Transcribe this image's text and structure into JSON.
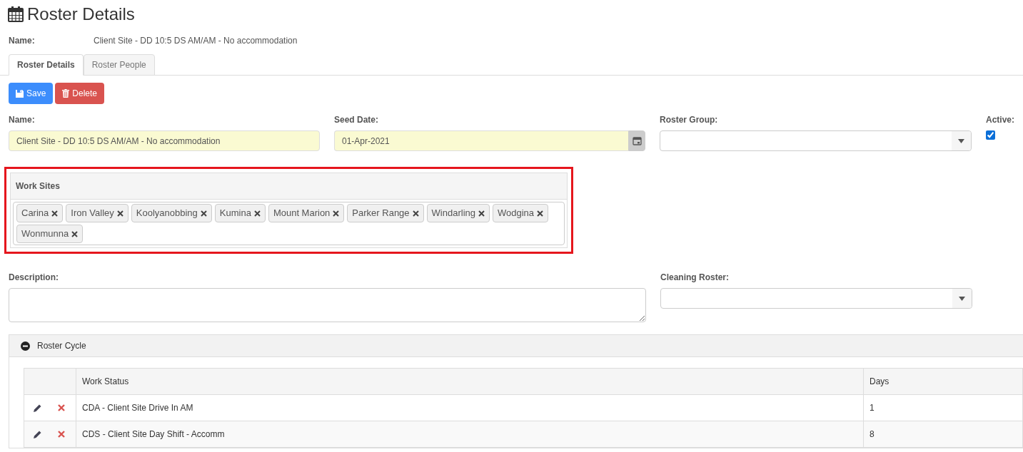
{
  "page": {
    "title": "Roster Details"
  },
  "summary": {
    "label": "Name:",
    "value": "Client Site - DD 10:5 DS AM/AM - No accommodation"
  },
  "tabs": [
    {
      "label": "Roster Details",
      "selected": true
    },
    {
      "label": "Roster People",
      "selected": false
    }
  ],
  "actions": [
    {
      "kind": "save",
      "label": "Save"
    },
    {
      "kind": "delete",
      "label": "Delete"
    }
  ],
  "fields": {
    "name": {
      "label": "Name:",
      "value": "Client Site - DD 10:5 DS AM/AM - No accommodation"
    },
    "seed_date": {
      "label": "Seed Date:",
      "value": "01-Apr-2021"
    },
    "roster_group": {
      "label": "Roster Group:"
    },
    "active": {
      "label": "Active:",
      "checked": true
    }
  },
  "work_sites": {
    "title": "Work Sites",
    "highlighted": true,
    "tags": [
      "Carina",
      "Iron Valley",
      "Koolyanobbing",
      "Kumina",
      "Mount Marion",
      "Parker Range",
      "Windarling",
      "Wodgina",
      "Wonmunna"
    ]
  },
  "description": {
    "label": "Description:"
  },
  "cleaning_roster": {
    "label": "Cleaning Roster:"
  },
  "roster_cycle": {
    "title": "Roster Cycle",
    "expanded": true,
    "columns": [
      "Work Status",
      "Days"
    ],
    "rows": [
      {
        "work_status": "CDA - Client Site Drive In AM",
        "days": "1"
      },
      {
        "work_status": "CDS - Client Site Day Shift - Accomm",
        "days": "8"
      }
    ]
  }
}
